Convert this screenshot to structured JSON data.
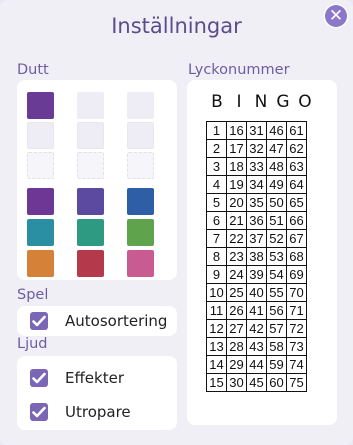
{
  "title": "Inställningar",
  "close_icon": "close-icon",
  "sections": {
    "dutt": "Dutt",
    "lyckonummer": "Lyckonummer",
    "spel": "Spel",
    "ljud": "Ljud"
  },
  "dabber_colors": [
    "#6a3b95",
    "#eeedf5",
    "#eeedf5",
    "#eeedf5",
    "#eeedf5",
    "#eeedf5",
    "#f6f5fa",
    "#f6f5fa",
    "#f6f5fa",
    "#6e3796",
    "#5b4aa0",
    "#2e5fa6",
    "#2a8fa3",
    "#2f9a82",
    "#5fa34d",
    "#d58238",
    "#b4394a",
    "#c95b93"
  ],
  "bingo_letters": [
    "B",
    "I",
    "N",
    "G",
    "O"
  ],
  "lucky_rows": [
    [
      "1",
      "16",
      "31",
      "46",
      "61"
    ],
    [
      "2",
      "17",
      "32",
      "47",
      "62"
    ],
    [
      "3",
      "18",
      "33",
      "48",
      "63"
    ],
    [
      "4",
      "19",
      "34",
      "49",
      "64"
    ],
    [
      "5",
      "20",
      "35",
      "50",
      "65"
    ],
    [
      "6",
      "21",
      "36",
      "51",
      "66"
    ],
    [
      "7",
      "22",
      "37",
      "52",
      "67"
    ],
    [
      "8",
      "23",
      "38",
      "53",
      "68"
    ],
    [
      "9",
      "24",
      "39",
      "54",
      "69"
    ],
    [
      "10",
      "25",
      "40",
      "55",
      "70"
    ],
    [
      "11",
      "26",
      "41",
      "56",
      "71"
    ],
    [
      "12",
      "27",
      "42",
      "57",
      "72"
    ],
    [
      "13",
      "28",
      "43",
      "58",
      "73"
    ],
    [
      "14",
      "29",
      "44",
      "59",
      "74"
    ],
    [
      "15",
      "30",
      "45",
      "60",
      "75"
    ]
  ],
  "options": {
    "autosort": {
      "label": "Autosortering",
      "checked": true
    },
    "effects": {
      "label": "Effekter",
      "checked": true
    },
    "caller": {
      "label": "Utropare",
      "checked": true
    }
  }
}
